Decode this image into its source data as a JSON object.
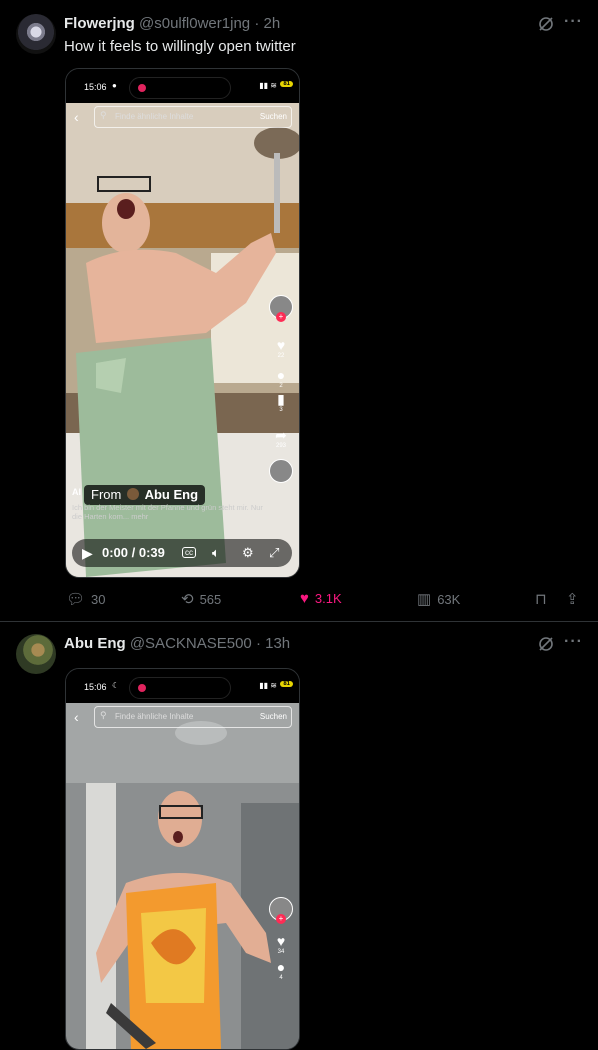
{
  "tweets": [
    {
      "name": "Flowerjng",
      "handle": "@s0ulfl0wer1jng",
      "dot": "·",
      "time": "2h",
      "text": "How it feels to willingly open twitter",
      "video": {
        "status_time": "15:06",
        "battery": "81",
        "search_placeholder": "Finde ähnliche Inhalte",
        "search_button": "Suchen",
        "from_label": "From",
        "from_name": "Abu Eng",
        "caption_prefix": "Al",
        "caption": "Ich bin der Meister mit der Pfanne und grün steht mir. Nur die Harten kom... mehr",
        "rail": {
          "likes": "22",
          "comments": "2",
          "saves": "3",
          "shares": "293"
        },
        "time_display": "0:00 / 0:39"
      },
      "actions": {
        "replies": "30",
        "reposts": "565",
        "likes": "3.1K",
        "views": "63K"
      }
    },
    {
      "name": "Abu Eng",
      "handle": "@SACKNASE500",
      "dot": "·",
      "time": "13h",
      "video": {
        "status_time": "15:06",
        "battery": "81",
        "search_placeholder": "Finde ähnliche Inhalte",
        "search_button": "Suchen",
        "rail": {
          "likes": "34",
          "comments": "4"
        }
      }
    }
  ],
  "icons": [
    "grok-icon",
    "more-icon",
    "reply-icon",
    "repost-icon",
    "heart-icon",
    "views-icon",
    "bookmark-icon",
    "share-icon"
  ],
  "colors": {
    "like": "#f91880",
    "muted": "#71767b",
    "background": "#000000",
    "separator": "#2f3336"
  }
}
